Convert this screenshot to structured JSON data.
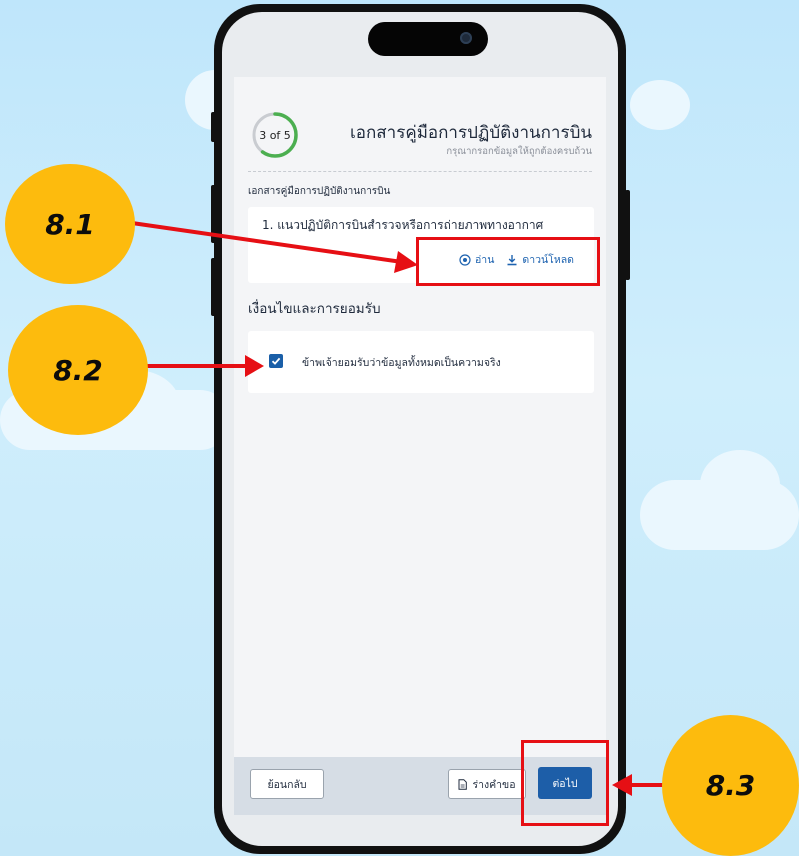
{
  "progress": {
    "text": "3 of 5",
    "fraction": 0.6
  },
  "header": {
    "title": "เอกสารคู่มือการปฏิบัติงานการบิน",
    "subtitle": "กรุณากรอกข้อมูลให้ถูกต้องครบถ้วน"
  },
  "section_label": "เอกสารคู่มือการปฏิบัติงานการบิน",
  "document": {
    "title": "1. แนวปฏิบัติการบินสำรวจหรือการถ่ายภาพทางอากาศ",
    "read_label": "อ่าน",
    "download_label": "ดาวน์โหลด"
  },
  "terms": {
    "heading": "เงื่อนไขและการยอมรับ",
    "checkbox_label": "ข้าพเจ้ายอมรับว่าข้อมูลทั้งหมดเป็นความจริง",
    "checked": true
  },
  "footer": {
    "back_label": "ย้อนกลับ",
    "draft_label": "ร่างคำขอ",
    "next_label": "ต่อไป"
  },
  "callouts": [
    "8.1",
    "8.2",
    "8.3"
  ],
  "colors": {
    "accent": "#1d5ea8",
    "progress": "#4caf50",
    "callout": "#fdbb0d",
    "highlight": "#e60f14"
  }
}
